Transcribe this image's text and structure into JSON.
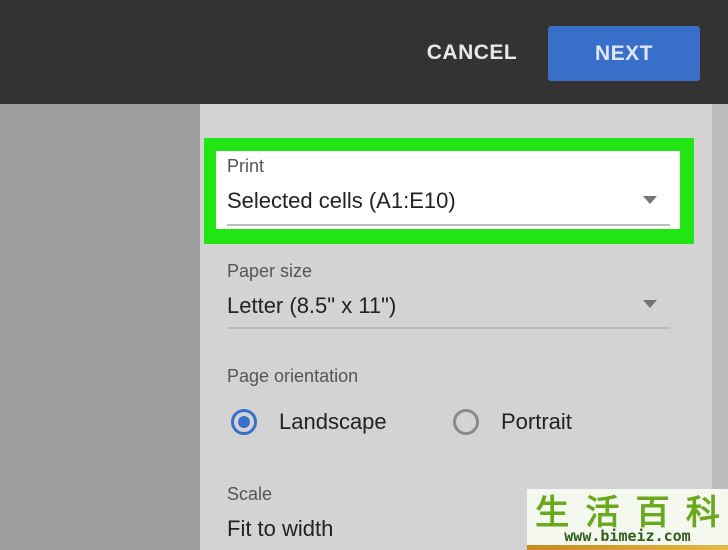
{
  "header": {
    "cancel_label": "CANCEL",
    "next_label": "NEXT"
  },
  "print_field": {
    "label": "Print",
    "value": "Selected cells (A1:E10)"
  },
  "paper_size_field": {
    "label": "Paper size",
    "value": "Letter (8.5\" x 11\")"
  },
  "orientation": {
    "label": "Page orientation",
    "options": [
      {
        "label": "Landscape",
        "selected": true
      },
      {
        "label": "Portrait",
        "selected": false
      }
    ]
  },
  "scale_field": {
    "label": "Scale",
    "value": "Fit to width"
  },
  "watermark": {
    "chars": [
      "生",
      "活",
      "百",
      "科"
    ],
    "url": "www.bimeiz.com"
  },
  "colors": {
    "accent_blue": "#3a6fc9",
    "highlight_green": "#22e614",
    "topbar": "#333333"
  },
  "icons": [
    "dropdown-caret-icon",
    "radio-selected-icon",
    "radio-unselected-icon"
  ]
}
